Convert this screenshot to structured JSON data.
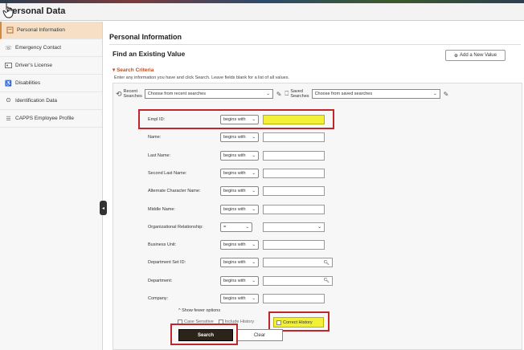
{
  "page": {
    "title": "Personal Data"
  },
  "sidebar": {
    "items": [
      {
        "label": "Personal Information",
        "icon": "document-icon",
        "active": true
      },
      {
        "label": "Emergency Contact",
        "icon": "phone-icon"
      },
      {
        "label": "Driver's License",
        "icon": "id-card-icon"
      },
      {
        "label": "Disabilities",
        "icon": "accessibility-icon"
      },
      {
        "label": "Identification Data",
        "icon": "fingerprint-icon"
      },
      {
        "label": "CAPPS Employee Profile",
        "icon": "profile-icon"
      }
    ]
  },
  "main": {
    "title": "Personal Information",
    "find_title": "Find an Existing Value",
    "add_button": "Add a New Value",
    "criteria_heading": "Search Criteria",
    "instructions": "Enter any information you have and click Search. Leave fields blank for a list of all values.",
    "recent_label_1": "Recent",
    "recent_label_2": "Searches",
    "recent_placeholder": "Choose from recent searches",
    "saved_label_1": "Saved",
    "saved_label_2": "Searches",
    "saved_placeholder": "Choose from saved searches"
  },
  "fields": [
    {
      "label": "Empl ID:",
      "op": "begins with",
      "search": false,
      "highlight": true
    },
    {
      "label": "Name:",
      "op": "begins with",
      "search": false
    },
    {
      "label": "Last Name:",
      "op": "begins with",
      "search": false
    },
    {
      "label": "Second Last Name:",
      "op": "begins with",
      "search": false
    },
    {
      "label": "Alternate Character Name:",
      "op": "begins with",
      "search": false
    },
    {
      "label": "Middle Name:",
      "op": "begins with",
      "search": false
    },
    {
      "label": "Organizational Relationship:",
      "op": "=",
      "search": false,
      "dropdown": true
    },
    {
      "label": "Business Unit:",
      "op": "begins with",
      "search": false
    },
    {
      "label": "Department Set ID:",
      "op": "begins with",
      "search": true
    },
    {
      "label": "Department:",
      "op": "begins with",
      "search": true
    },
    {
      "label": "Company:",
      "op": "begins with",
      "search": false
    }
  ],
  "options": {
    "fewer": "Show fewer options",
    "case_sensitive": "Case Sensitive",
    "include_history": "Include History",
    "correct_history": "Correct History"
  },
  "buttons": {
    "search": "Search",
    "clear": "Clear"
  },
  "colors": {
    "highlight": "#f3f03a",
    "callout": "#c0272d",
    "active_nav": "#f6dfc5"
  }
}
